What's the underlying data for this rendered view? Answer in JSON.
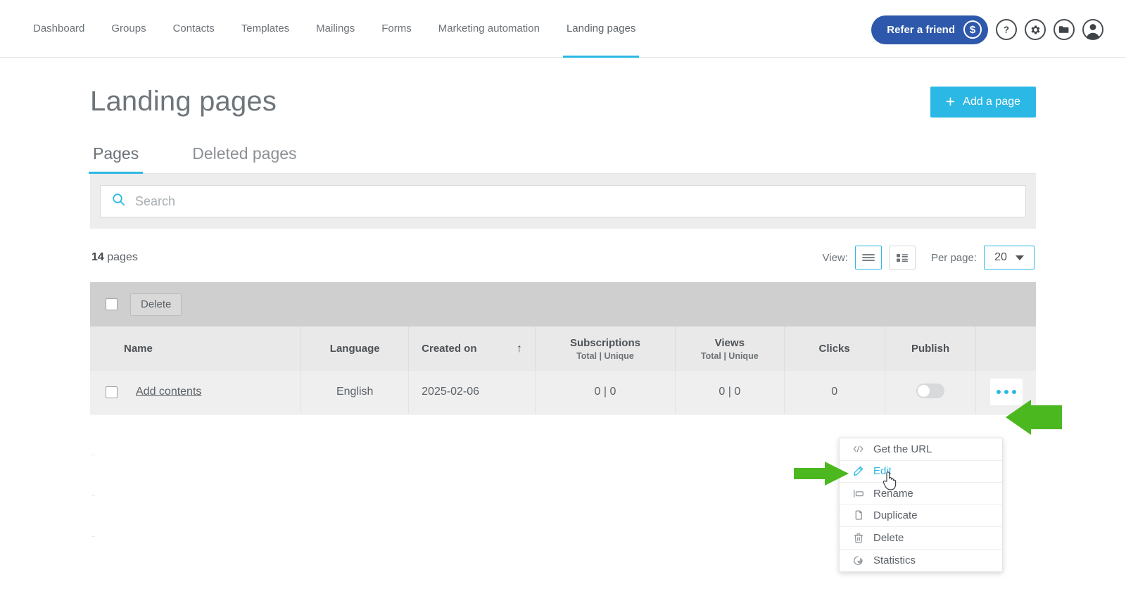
{
  "nav": {
    "items": [
      {
        "label": "Dashboard",
        "active": false
      },
      {
        "label": "Groups",
        "active": false
      },
      {
        "label": "Contacts",
        "active": false
      },
      {
        "label": "Templates",
        "active": false
      },
      {
        "label": "Mailings",
        "active": false
      },
      {
        "label": "Forms",
        "active": false
      },
      {
        "label": "Marketing automation",
        "active": false
      },
      {
        "label": "Landing pages",
        "active": true
      }
    ],
    "refer_label": "Refer a friend",
    "refer_icon": "dollar-circle-icon",
    "help_icon": "question-mark-icon",
    "settings_icon": "gear-icon",
    "folder_icon": "folder-icon",
    "account_icon": "user-avatar-icon"
  },
  "page": {
    "title": "Landing pages",
    "add_button": "Add a page",
    "add_button_icon": "plus-icon"
  },
  "tabs": [
    {
      "label": "Pages",
      "active": true
    },
    {
      "label": "Deleted pages",
      "active": false
    }
  ],
  "search": {
    "placeholder": "Search",
    "value": "",
    "icon": "search-icon"
  },
  "list_controls": {
    "count_number": "14",
    "count_word": "pages",
    "view_label": "View:",
    "view_list_icon": "list-view-icon",
    "view_grid_icon": "grid-view-icon",
    "per_page_label": "Per page:",
    "per_page_value": "20"
  },
  "toolbar": {
    "delete_label": "Delete"
  },
  "table": {
    "columns": [
      {
        "label": "Name",
        "sub": "",
        "sorted": false
      },
      {
        "label": "Language",
        "sub": "",
        "sorted": false
      },
      {
        "label": "Created on",
        "sub": "",
        "sorted": true,
        "sort_dir": "↑"
      },
      {
        "label": "Subscriptions",
        "sub": "Total | Unique",
        "sorted": false
      },
      {
        "label": "Views",
        "sub": "Total | Unique",
        "sorted": false
      },
      {
        "label": "Clicks",
        "sub": "",
        "sorted": false
      },
      {
        "label": "Publish",
        "sub": "",
        "sorted": false
      }
    ],
    "rows": [
      {
        "name": "Add contents",
        "language": "English",
        "created_on": "2025-02-06",
        "subscriptions": "0 | 0",
        "views": "0 | 0",
        "clicks": "0",
        "published": false,
        "actions_icon": "three-dots-icon"
      }
    ]
  },
  "context_menu": {
    "items": [
      {
        "label": "Get the URL",
        "icon": "code-icon",
        "hover": false
      },
      {
        "label": "Edit",
        "icon": "pencil-icon",
        "hover": true
      },
      {
        "label": "Rename",
        "icon": "rename-tag-icon",
        "hover": false
      },
      {
        "label": "Duplicate",
        "icon": "duplicate-icon",
        "hover": false
      },
      {
        "label": "Delete",
        "icon": "trash-icon",
        "hover": false
      },
      {
        "label": "Statistics",
        "icon": "pie-chart-icon",
        "hover": false
      }
    ]
  },
  "annotations": {
    "arrow_color": "#4cb820",
    "arrow_to_dots": "arrow-pointing-to-actions-menu",
    "arrow_to_edit": "arrow-pointing-to-edit-item"
  },
  "colors": {
    "accent_cyan": "#2cb8e5",
    "refer_blue": "#2d58ab",
    "text_gray": "#5b6167",
    "annotation_green": "#4cb820"
  }
}
